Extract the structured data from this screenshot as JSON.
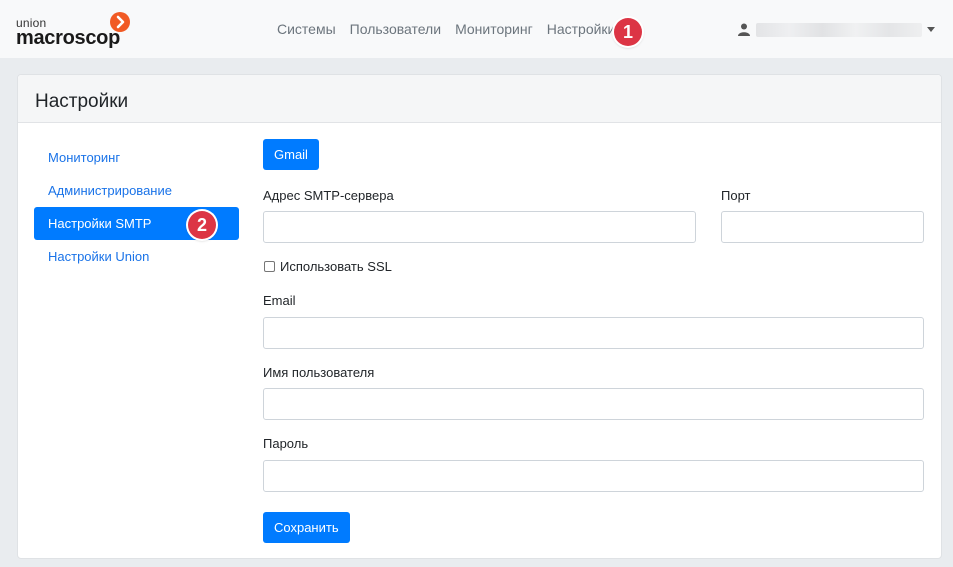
{
  "brand": {
    "small": "union",
    "big": "macroscop"
  },
  "nav": [
    "Системы",
    "Пользователи",
    "Мониторинг",
    "Настройки"
  ],
  "badges": {
    "first": "1",
    "second": "2"
  },
  "page_title": "Настройки",
  "sidebar": {
    "items": [
      {
        "label": "Мониторинг",
        "active": false
      },
      {
        "label": "Администрирование",
        "active": false
      },
      {
        "label": "Настройки SMTP",
        "active": true
      },
      {
        "label": "Настройки Union",
        "active": false
      }
    ]
  },
  "form": {
    "preset_button": "Gmail",
    "smtp_server_label": "Адрес SMTP-сервера",
    "smtp_server_value": "",
    "port_label": "Порт",
    "port_value": "",
    "ssl_label": "Использовать SSL",
    "ssl_checked": false,
    "email_label": "Email",
    "email_value": "",
    "username_label": "Имя пользователя",
    "username_value": "",
    "password_label": "Пароль",
    "password_value": "",
    "save_button": "Сохранить"
  },
  "colors": {
    "accent": "#007bff",
    "link": "#1a73e8",
    "badge": "#dc3545",
    "brand_mark": "#f15a24"
  }
}
